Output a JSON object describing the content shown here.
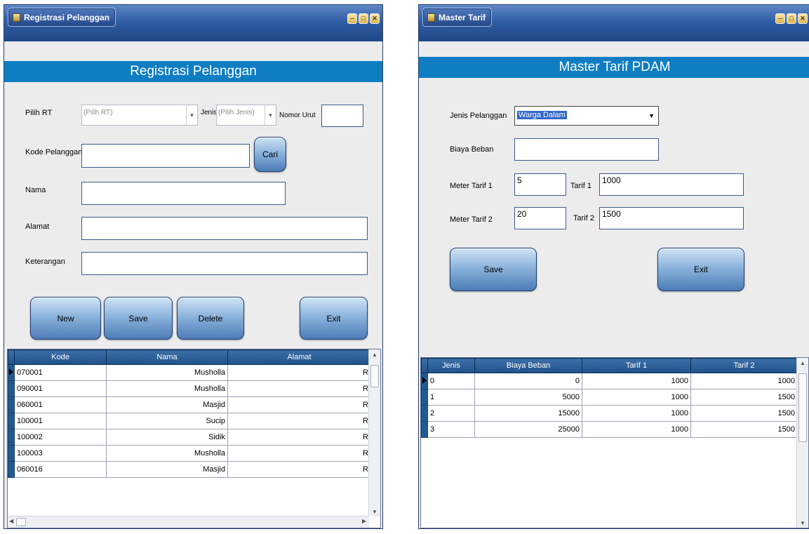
{
  "win1": {
    "title": "Registrasi Pelanggan",
    "banner": "Registrasi Pelanggan",
    "form": {
      "pilih_rt_label": "Pilih RT",
      "pilih_rt_value": "(Pilih RT)",
      "jenis_label": "Jenis",
      "jenis_value": "(Pilih Jenis)",
      "nomor_urut_label": "Nomor Urut",
      "nomor_urut_value": "",
      "kode_label": "Kode Pelanggan",
      "kode_value": "",
      "cari_label": "Cari",
      "nama_label": "Nama",
      "nama_value": "",
      "alamat_label": "Alamat",
      "alamat_value": "",
      "keterangan_label": "Keterangan",
      "keterangan_value": ""
    },
    "buttons": {
      "new": "New",
      "save": "Save",
      "delete": "Delete",
      "exit": "Exit"
    },
    "table": {
      "headers": [
        "Kode",
        "Nama",
        "Alamat"
      ],
      "rows": [
        {
          "kode": "070001",
          "nama": "Musholla",
          "alamat": "R"
        },
        {
          "kode": "090001",
          "nama": "Musholla",
          "alamat": "R"
        },
        {
          "kode": "060001",
          "nama": "Masjid",
          "alamat": "R"
        },
        {
          "kode": "100001",
          "nama": "Sucip",
          "alamat": "R"
        },
        {
          "kode": "100002",
          "nama": "Sidik",
          "alamat": "R"
        },
        {
          "kode": "100003",
          "nama": "Musholla",
          "alamat": "R"
        },
        {
          "kode": "060016",
          "nama": "Masjid",
          "alamat": "R"
        }
      ]
    }
  },
  "win2": {
    "title": "Master Tarif",
    "banner": "Master Tarif PDAM",
    "form": {
      "jenis_label": "Jenis Pelanggan",
      "jenis_value": "Warga Dalam",
      "biaya_label": "Biaya Beban",
      "biaya_value": "",
      "meter1_label": "Meter Tarif 1",
      "meter1_value": "5",
      "tarif1_label": "Tarif 1",
      "tarif1_value": "1000",
      "meter2_label": "Meter Tarif 2",
      "meter2_value": "20",
      "tarif2_label": "Tarif 2",
      "tarif2_value": "1500"
    },
    "buttons": {
      "save": "Save",
      "exit": "Exit"
    },
    "table": {
      "headers": [
        "Jenis",
        "Biaya Beban",
        "Tarif 1",
        "Tarif 2"
      ],
      "rows": [
        {
          "jenis": "0",
          "biaya": "0",
          "tarif1": "1000",
          "tarif2": "1000"
        },
        {
          "jenis": "1",
          "biaya": "5000",
          "tarif1": "1000",
          "tarif2": "1500"
        },
        {
          "jenis": "2",
          "biaya": "15000",
          "tarif1": "1000",
          "tarif2": "1500"
        },
        {
          "jenis": "3",
          "biaya": "25000",
          "tarif1": "1000",
          "tarif2": "1500"
        }
      ]
    }
  },
  "icons": {
    "minimize": "minimize-icon",
    "restore": "restore-icon",
    "close": "close-icon",
    "dropdown": "chevron-down-icon",
    "row_pointer": "row-pointer-icon"
  },
  "colors": {
    "banner": "#0f7dc2",
    "titlebar": "#2f5ea4",
    "grid_header": "#1f5289",
    "selection": "#3268c7"
  }
}
